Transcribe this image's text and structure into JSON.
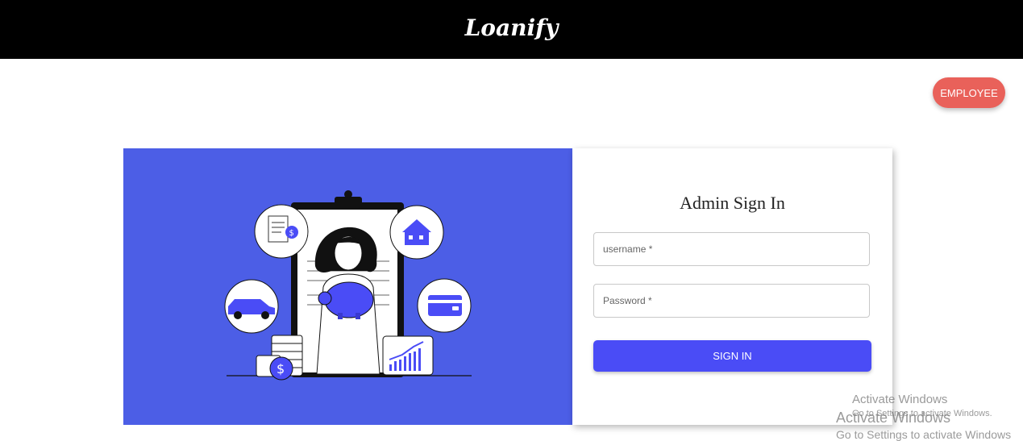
{
  "header": {
    "brand": "Loanify"
  },
  "employee_button": {
    "label": "EMPLOYEE"
  },
  "login_card": {
    "title": "Admin Sign In",
    "username_placeholder": "username *",
    "password_placeholder": "Password *",
    "signin_label": "SIGN IN"
  },
  "illustration": {
    "icons": [
      "document-dollar-icon",
      "house-icon",
      "car-icon",
      "credit-card-icon",
      "coin-stack-icon",
      "growth-chart-icon",
      "piggy-bank-icon"
    ]
  },
  "watermark": {
    "title": "Activate Windows",
    "subtitle": "Go to Settings to activate Windows."
  },
  "watermark_secondary": {
    "title": "Activate Windows",
    "subtitle": "Go to Settings to activate Windows"
  },
  "colors": {
    "topbar": "#000000",
    "illustration_bg": "#4c5ee6",
    "employee_button": "#e9615a",
    "signin_button": "#4a4cf6"
  }
}
